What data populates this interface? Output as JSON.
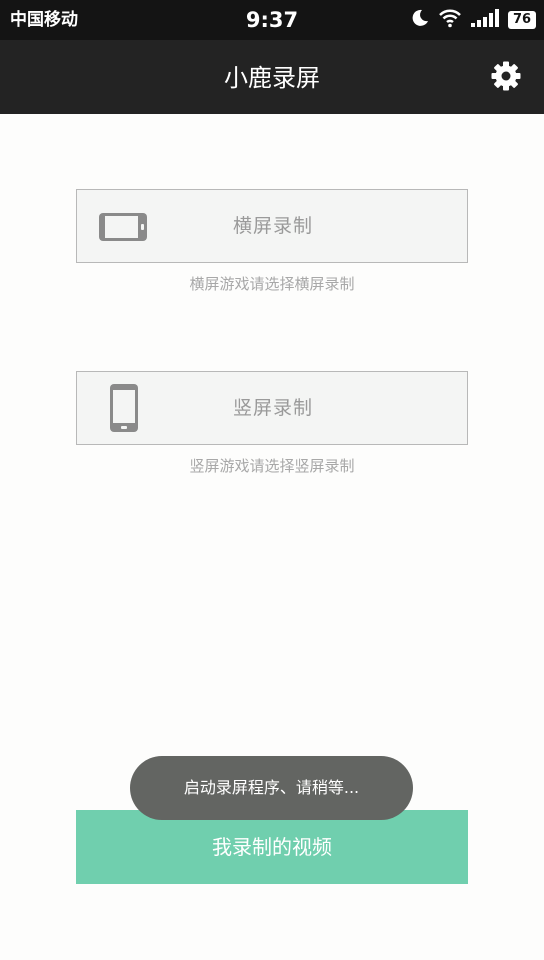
{
  "status_bar": {
    "carrier": "中国移动",
    "time": "9:37",
    "battery": "76",
    "icons": [
      "moon-icon",
      "wifi-icon",
      "signal-icon",
      "battery-icon"
    ]
  },
  "header": {
    "title": "小鹿录屏",
    "settings_icon": "gear-icon"
  },
  "modes": {
    "landscape": {
      "label": "横屏录制",
      "hint": "横屏游戏请选择横屏录制",
      "icon": "phone-landscape-icon"
    },
    "portrait": {
      "label": "竖屏录制",
      "hint": "竖屏游戏请选择竖屏录制",
      "icon": "phone-portrait-icon"
    }
  },
  "my_videos_label": "我录制的视频",
  "toast": "启动录屏程序、请稍等...",
  "colors": {
    "status_bar": "#141414",
    "title_bar": "#232323",
    "accent_green": "#70cfae",
    "toast_bg": "#636562",
    "icon_gray": "#8a8a8a"
  }
}
